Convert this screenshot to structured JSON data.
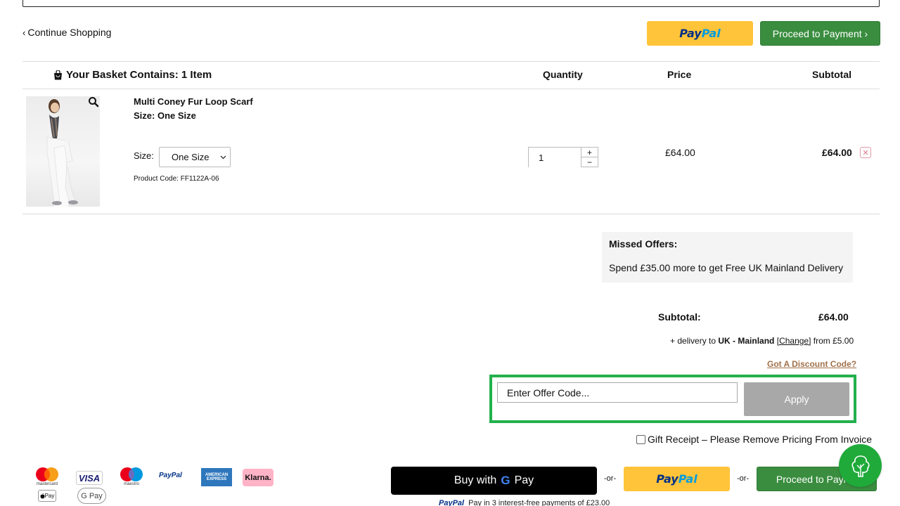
{
  "nav": {
    "continue_chevron": "‹",
    "continue_label": "Continue Shopping",
    "paypal_pay": "Pay",
    "paypal_pal": "Pal",
    "proceed_label": "Proceed to Payment ›"
  },
  "basket": {
    "title": "Your Basket Contains: 1 Item",
    "columns": {
      "quantity": "Quantity",
      "price": "Price",
      "subtotal": "Subtotal"
    },
    "items": [
      {
        "name": "Multi Coney Fur Loop Scarf",
        "size_line": "Size: One Size",
        "size_label": "Size:",
        "size_selected": "One Size",
        "product_code": "Product Code: FF1122A-06",
        "quantity": "1",
        "qty_plus": "+",
        "qty_minus": "−",
        "price": "£64.00",
        "subtotal": "£64.00",
        "remove_symbol": "✕"
      }
    ]
  },
  "offers": {
    "title": "Missed Offers:",
    "text": "Spend £35.00 more to get Free UK Mainland Delivery"
  },
  "summary": {
    "subtotal_label": "Subtotal:",
    "subtotal_value": "£64.00",
    "delivery_prefix": "+ delivery to",
    "delivery_region": "UK - Mainland",
    "delivery_change": "[Change]",
    "delivery_suffix": "from £5.00",
    "discount_link": "Got A Discount Code?",
    "offer_placeholder": "Enter Offer Code...",
    "apply_label": "Apply",
    "gift_receipt": "Gift Receipt – Please Remove Pricing From Invoice"
  },
  "payment_methods": {
    "mastercard": "mastercard",
    "visa": "VISA",
    "maestro": "maestro",
    "paypal": "PayPal",
    "amex": "AMERICAN EXPRESS",
    "klarna": "Klarna.",
    "applepay": "Pay",
    "gpay": "G Pay"
  },
  "checkout": {
    "gpay_label": "Buy with",
    "gpay_g": "G",
    "gpay_pay": "Pay",
    "or": "-or-",
    "proceed_label": "Proceed to Payme",
    "paylater_brand": "PayPal",
    "paylater_text": "Pay in 3 interest-free payments of £23.00"
  },
  "colors": {
    "green": "#3a8d3f",
    "paypal_yellow": "#ffc439",
    "highlight": "#22b14c",
    "discount_link": "#a0714a"
  }
}
